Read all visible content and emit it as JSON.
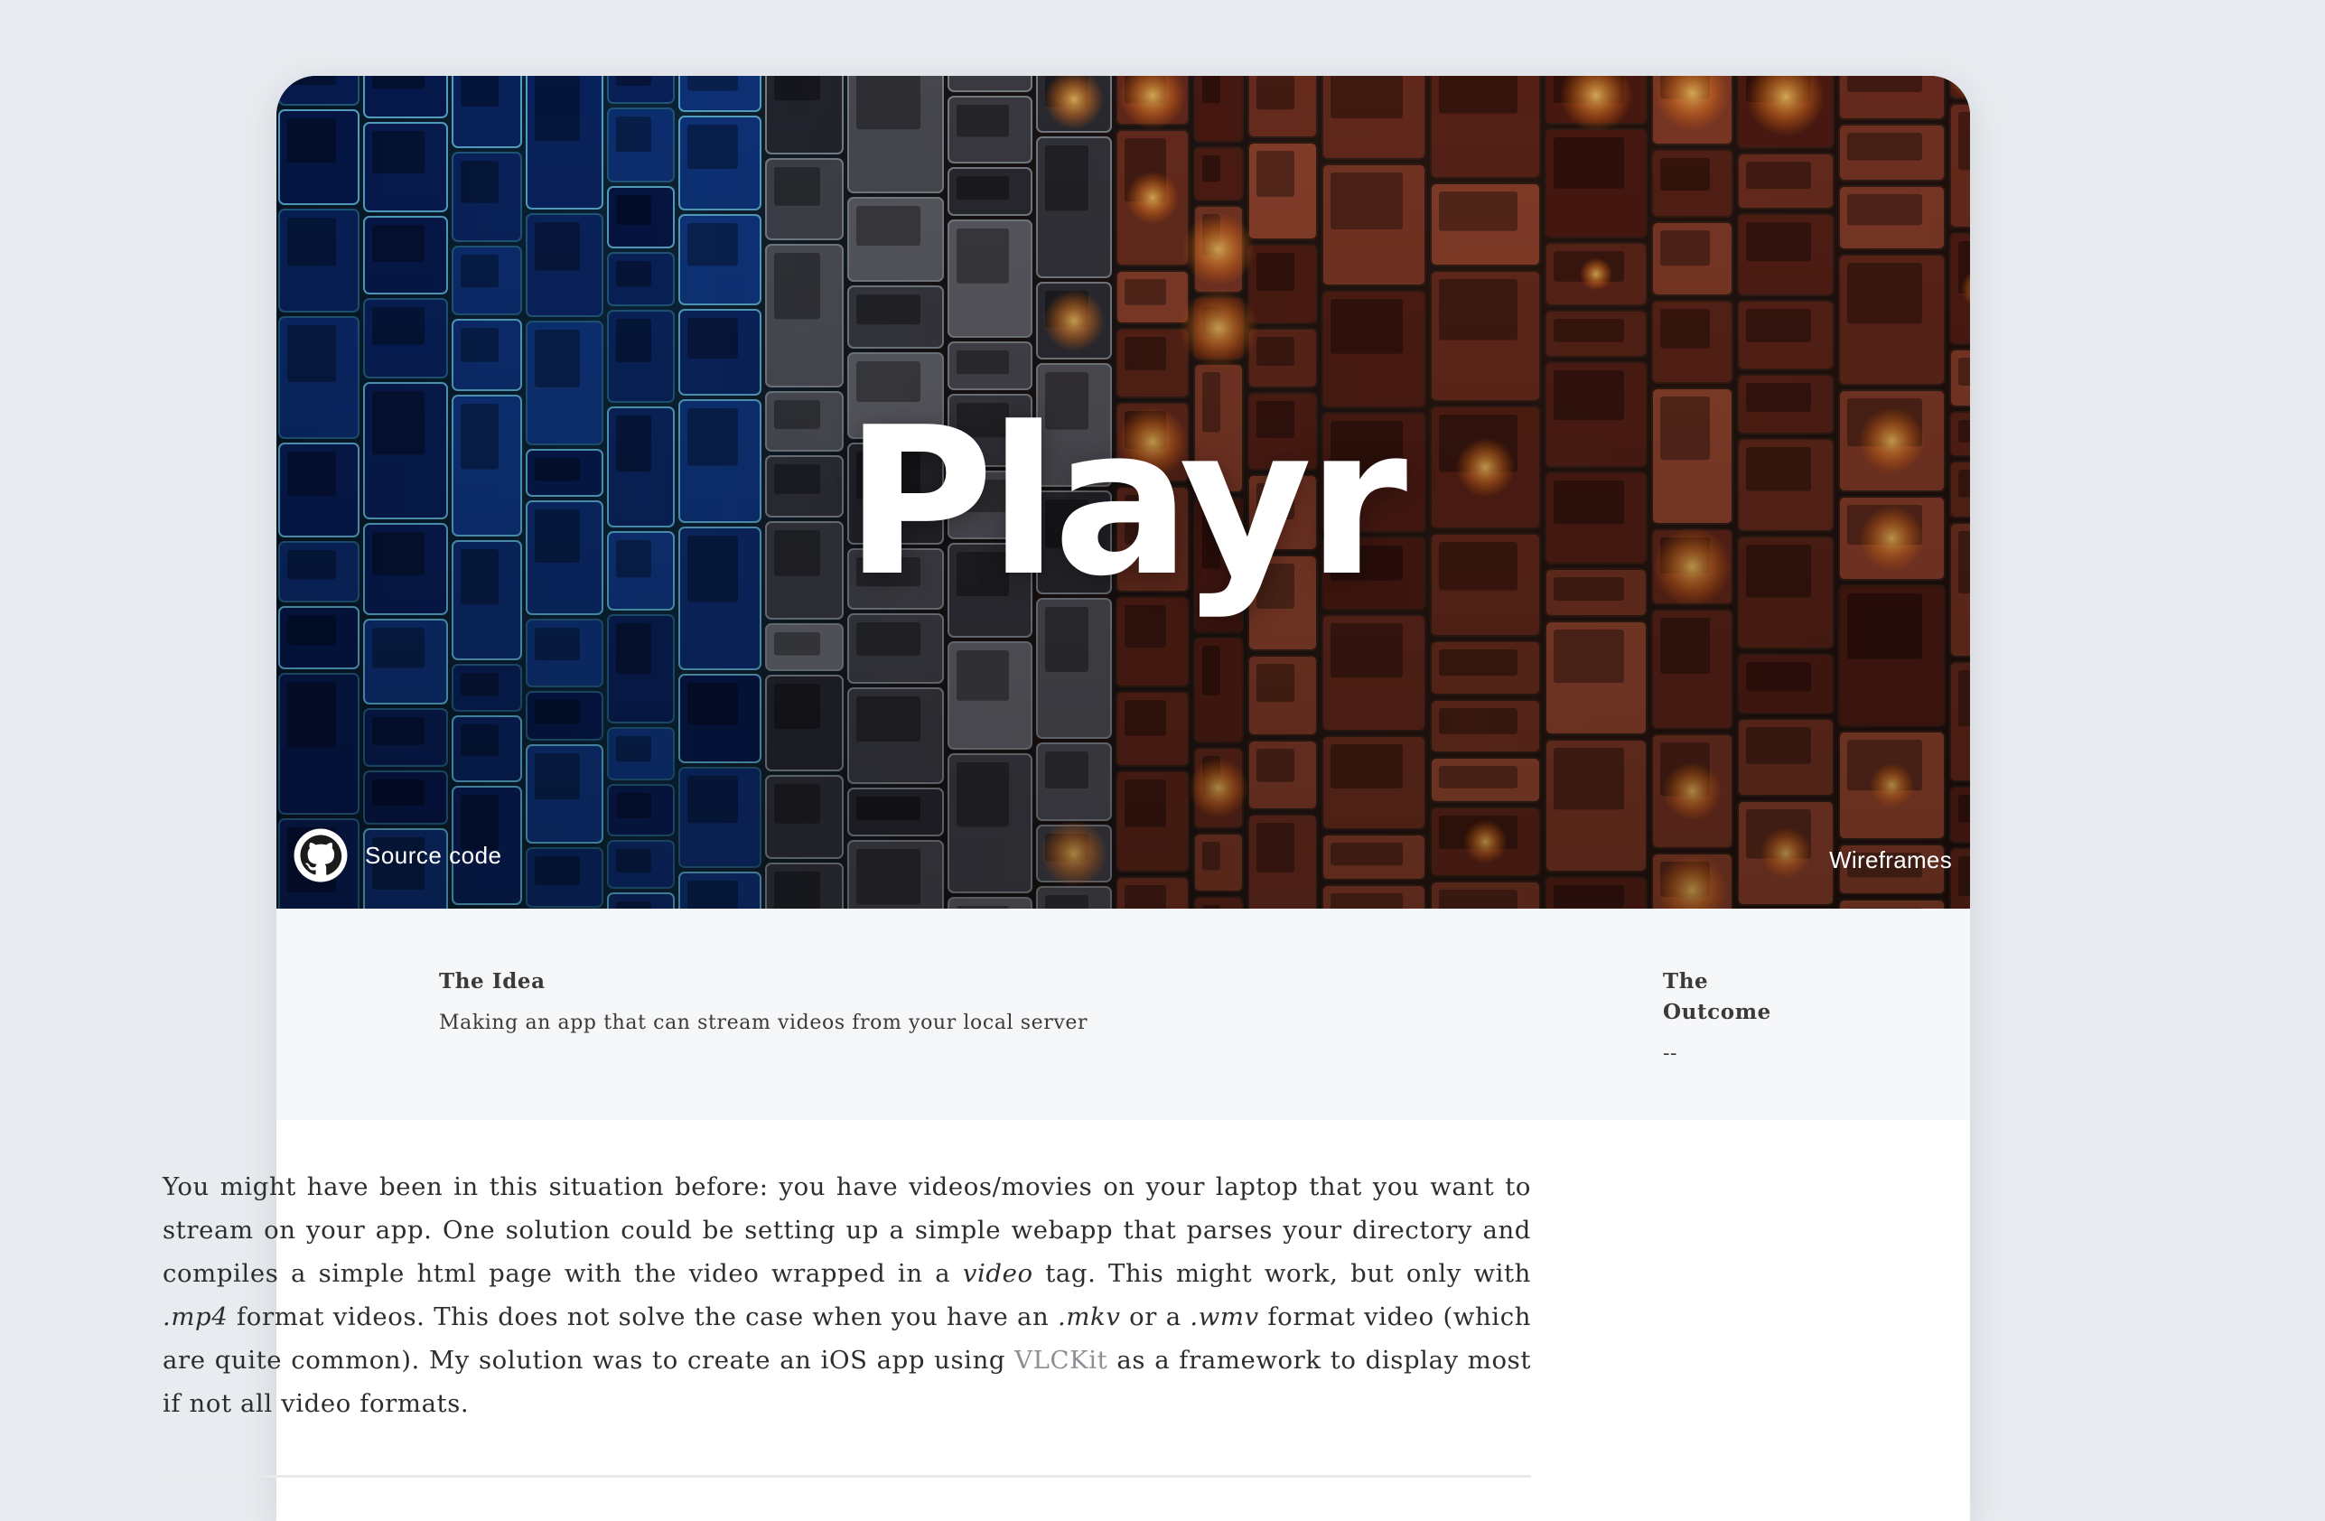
{
  "hero": {
    "title": "Playr",
    "source_label": "Source code",
    "wireframes_label": "Wireframes"
  },
  "summary": {
    "idea_heading": "The Idea",
    "idea_text": "Making an app that can stream videos from your local server",
    "outcome_heading": "The Outcome",
    "outcome_text": "--"
  },
  "body": {
    "p1_a": "You might have been in this situation before: you have videos/movies on your laptop that you want to stream on your app. One solution could be setting up a simple webapp that parses your directory and compiles a simple html page with the video wrapped in a ",
    "p1_em1": "video",
    "p1_b": " tag. This might work, but only with ",
    "p1_em2": ".mp4",
    "p1_c": " format videos. This does not solve the case when you have an ",
    "p1_em3": ".mkv",
    "p1_d": " or a ",
    "p1_em4": ".wmv",
    "p1_e": " format video (which are quite common). My solution was to create an iOS app using ",
    "p1_link": "VLCKit",
    "p1_f": " as a framework to display most if not all video formats."
  },
  "colors": {
    "page_bg": "#e8ebef",
    "summary_bg": "#f6f7f9",
    "link": "#8b8f93"
  },
  "icons": {
    "source": "github-icon"
  }
}
